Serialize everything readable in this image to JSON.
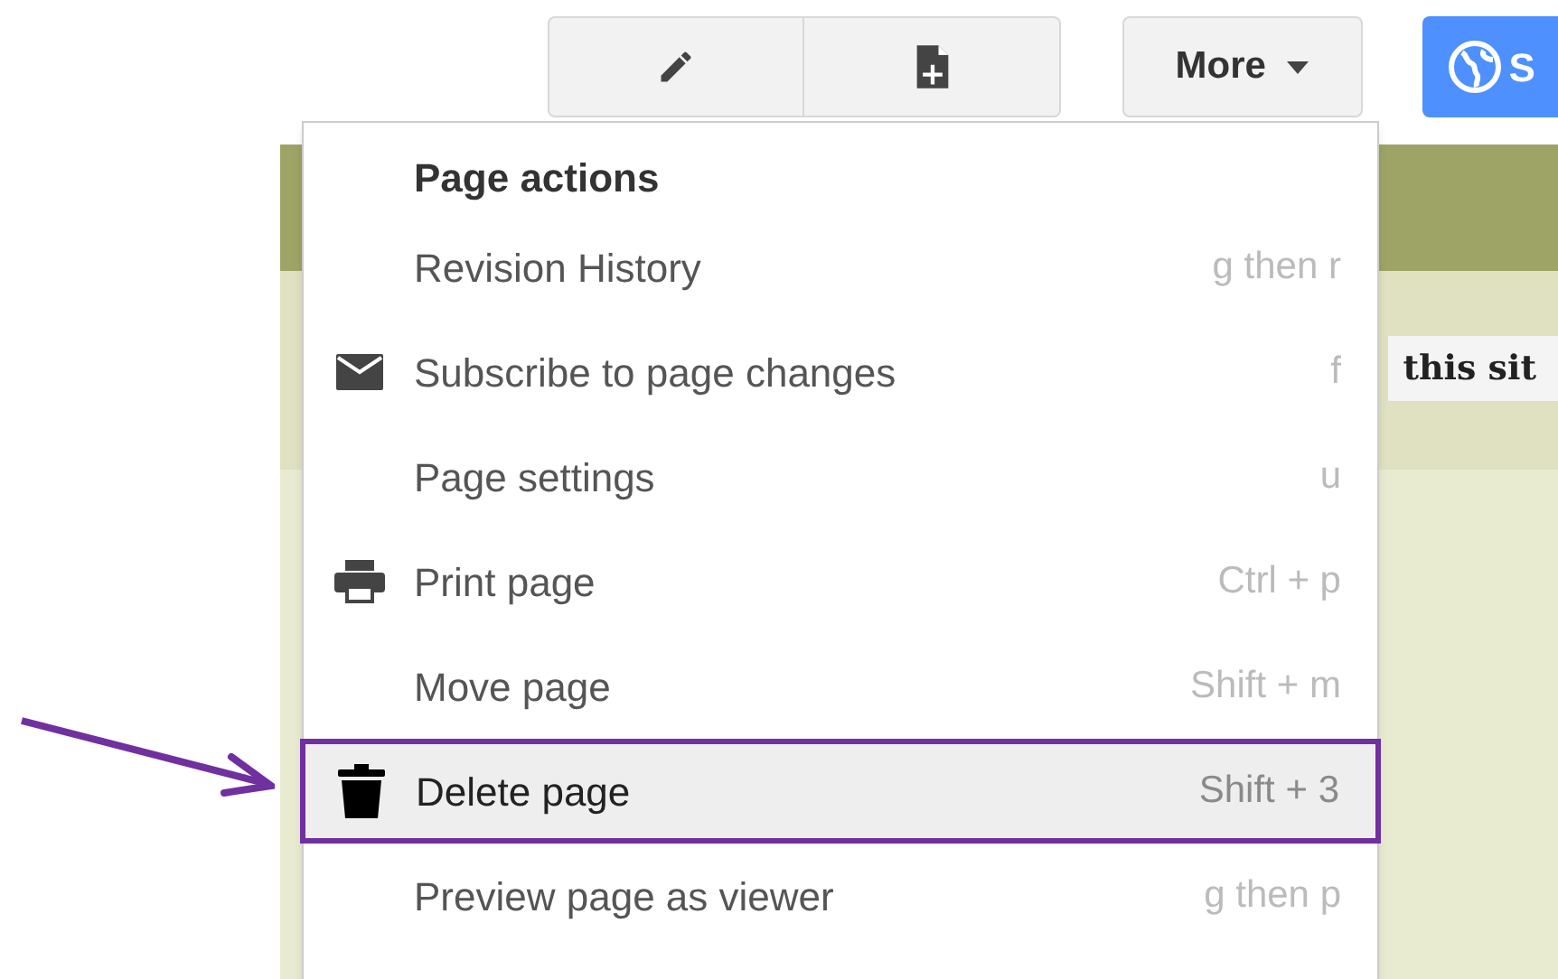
{
  "toolbar": {
    "more_button": {
      "label": "More"
    },
    "share_button": {
      "label": "S"
    }
  },
  "page": {
    "tag": "this sit"
  },
  "menu": {
    "header": "Page actions",
    "items": [
      {
        "label": "Revision History",
        "shortcut": "g then r",
        "selected": false
      },
      {
        "label": "Subscribe to page changes",
        "shortcut": "f",
        "selected": false
      },
      {
        "label": "Page settings",
        "shortcut": "u",
        "selected": false
      },
      {
        "label": "Print page",
        "shortcut": "Ctrl + p",
        "selected": false
      },
      {
        "label": "Move page",
        "shortcut": "Shift + m",
        "selected": false
      },
      {
        "label": "Delete page",
        "shortcut": "Shift + 3",
        "selected": true
      },
      {
        "label": "Preview page as viewer",
        "shortcut": "g then p",
        "selected": false
      }
    ]
  }
}
